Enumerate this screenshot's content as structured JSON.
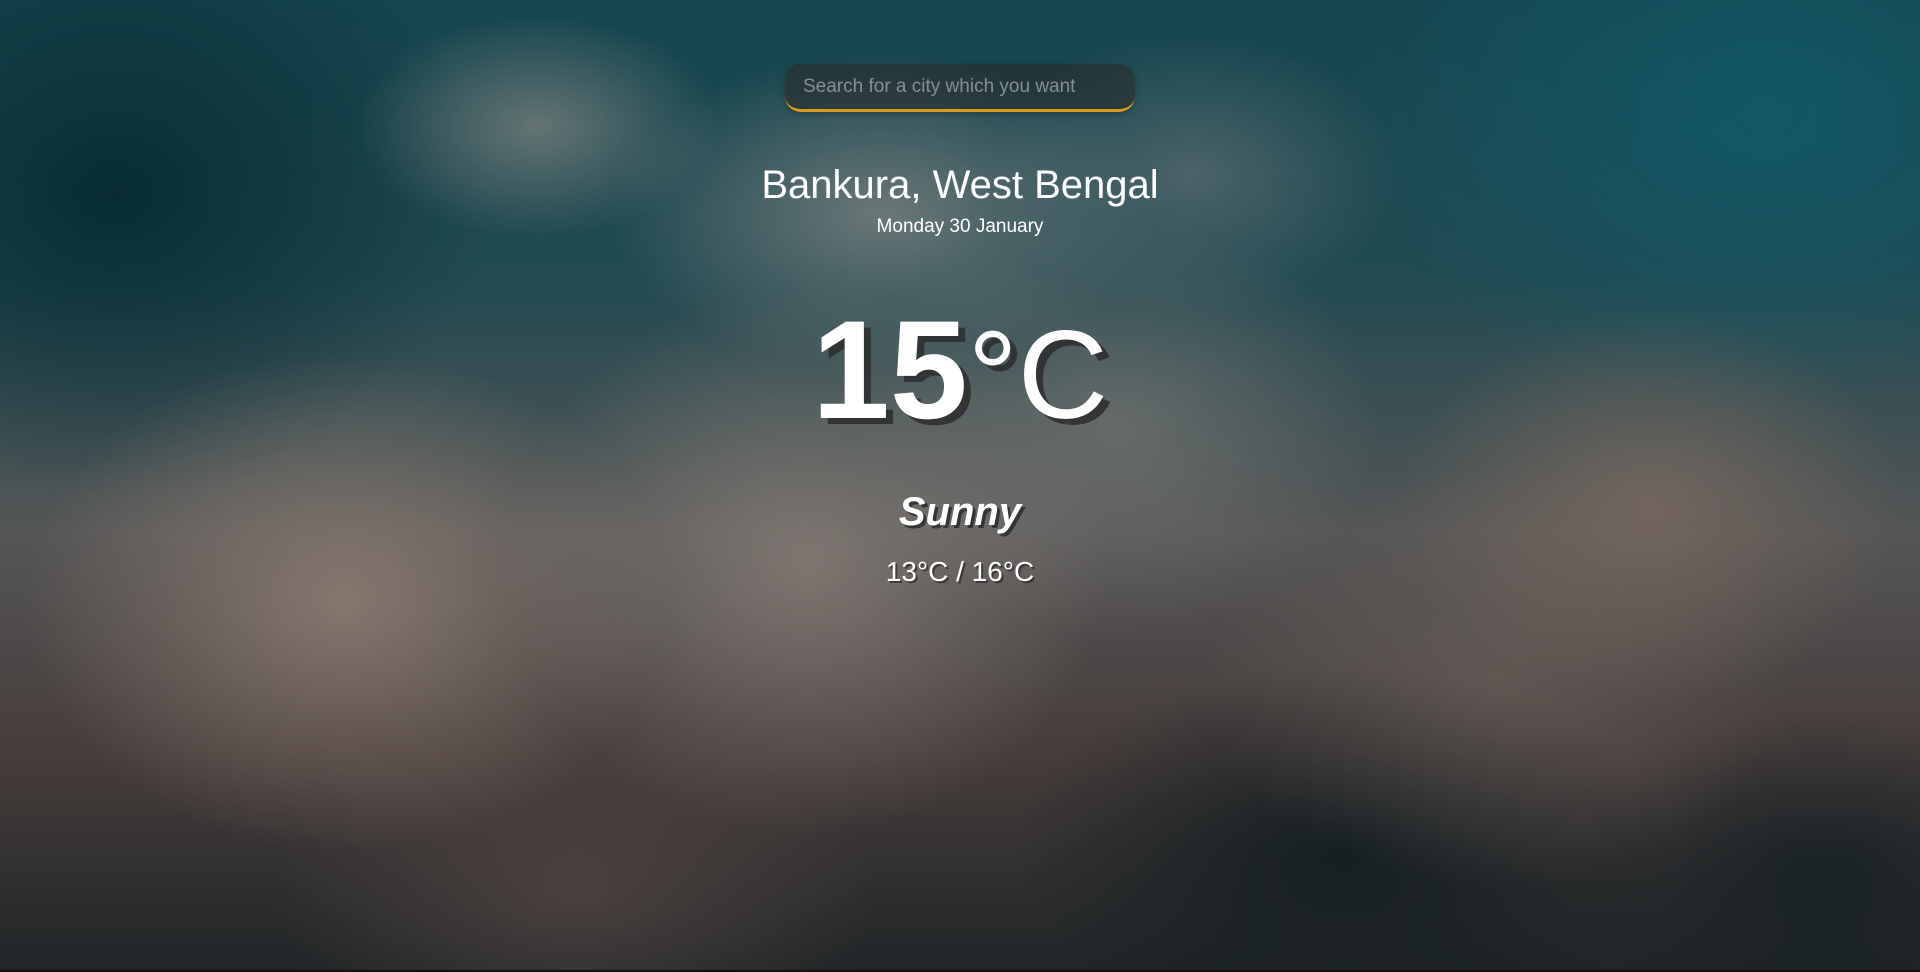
{
  "search": {
    "placeholder": "Search for a city which you want",
    "value": ""
  },
  "location": {
    "city_region": "Bankura, West Bengal",
    "date": "Monday 30 January"
  },
  "current": {
    "temperature": "15",
    "unit": "°C",
    "condition": "Sunny",
    "range": "13°C / 16°C"
  },
  "colors": {
    "search_underline": "#d99a1b",
    "text": "#ffffff"
  }
}
